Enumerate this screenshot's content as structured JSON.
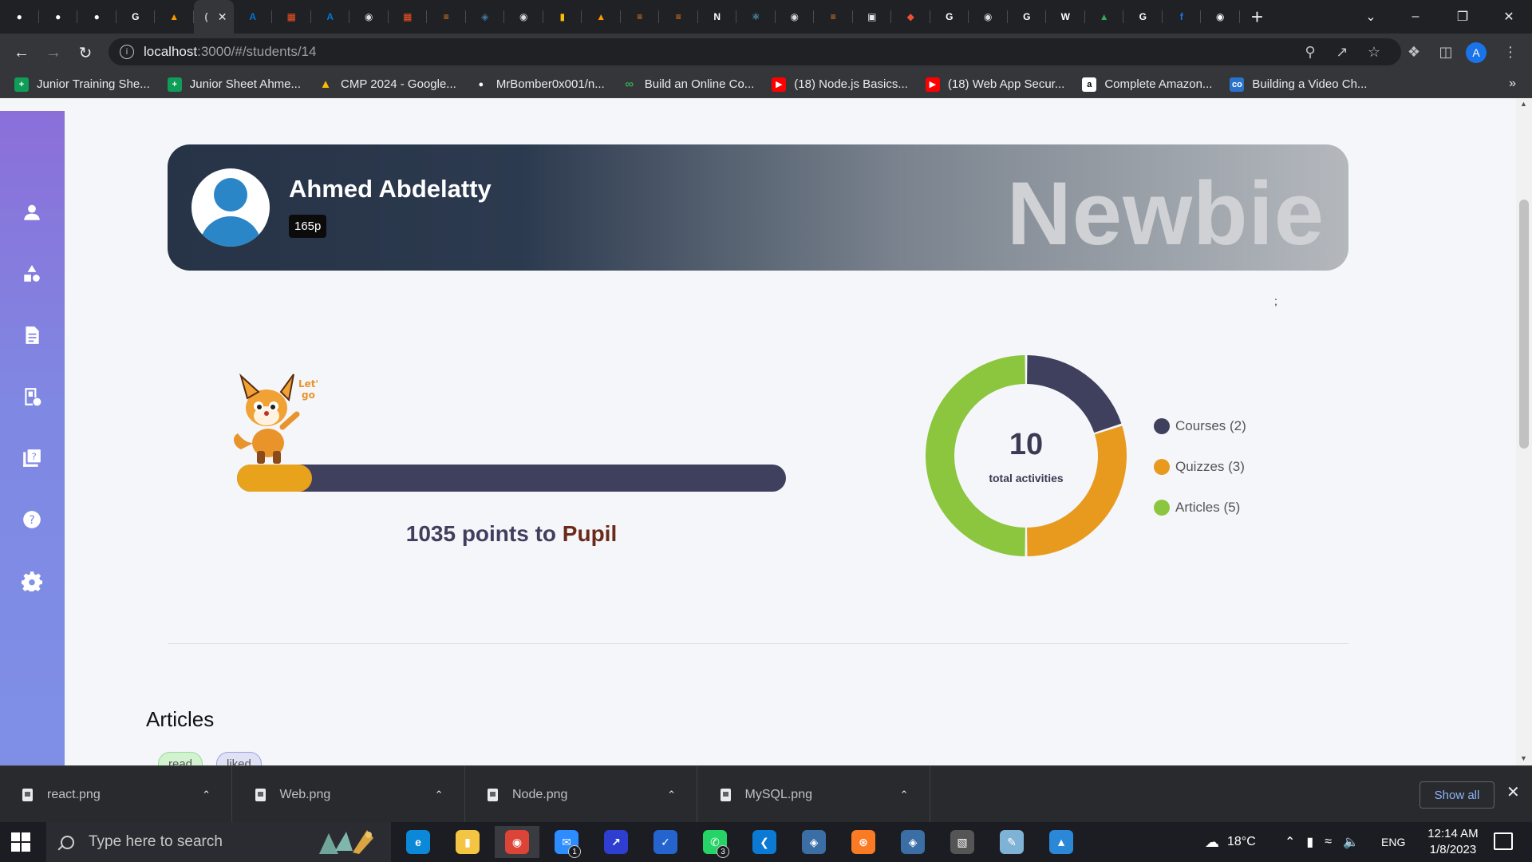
{
  "browser": {
    "tabs": [
      {
        "icon": "github-icon",
        "color": "#ffffff"
      },
      {
        "icon": "github-icon",
        "color": "#ffffff"
      },
      {
        "icon": "github-icon",
        "color": "#ffffff"
      },
      {
        "icon": "google-icon",
        "color": "#ffffff"
      },
      {
        "icon": "codeforces-icon",
        "color": "#ff9800"
      },
      {
        "icon": "localhost-loading-icon",
        "color": "#bdc1c6",
        "active": true
      },
      {
        "icon": "azure-icon",
        "color": "#0078d4"
      },
      {
        "icon": "microsoft-icon",
        "color": "#f25022"
      },
      {
        "icon": "azure-icon",
        "color": "#0078d4"
      },
      {
        "icon": "globe-icon",
        "color": "#dadce0"
      },
      {
        "icon": "microsoft-icon",
        "color": "#f25022"
      },
      {
        "icon": "stackoverflow-icon",
        "color": "#f48024"
      },
      {
        "icon": "mysql-icon",
        "color": "#4479a1"
      },
      {
        "icon": "globe-icon",
        "color": "#dadce0"
      },
      {
        "icon": "bookmark-icon",
        "color": "#fbbc04"
      },
      {
        "icon": "codeforces-icon",
        "color": "#ff9800"
      },
      {
        "icon": "stackoverflow-icon",
        "color": "#f48024"
      },
      {
        "icon": "stackoverflow-icon",
        "color": "#f48024"
      },
      {
        "icon": "notion-icon",
        "color": "#ffffff"
      },
      {
        "icon": "react-icon",
        "color": "#61dafb"
      },
      {
        "icon": "globe-icon",
        "color": "#dadce0"
      },
      {
        "icon": "stackoverflow-icon",
        "color": "#f48024"
      },
      {
        "icon": "package-icon",
        "color": "#e8eaed"
      },
      {
        "icon": "git-icon",
        "color": "#f05032"
      },
      {
        "icon": "google-icon",
        "color": "#ffffff"
      },
      {
        "icon": "globe-icon",
        "color": "#dadce0"
      },
      {
        "icon": "google-icon",
        "color": "#ffffff"
      },
      {
        "icon": "wikipedia-icon",
        "color": "#ffffff"
      },
      {
        "icon": "google-drive-icon",
        "color": "#34a853"
      },
      {
        "icon": "google-icon",
        "color": "#ffffff"
      },
      {
        "icon": "facebook-icon",
        "color": "#1877f2"
      },
      {
        "icon": "chrome-icon",
        "color": "#ffffff"
      }
    ],
    "url_host": "localhost",
    "url_path": ":3000/#/students/14",
    "profile_initial": "A",
    "bookmarks": [
      {
        "label": "Junior Training She...",
        "icon": "sheets-icon",
        "color": "#0f9d58"
      },
      {
        "label": "Junior Sheet Ahme...",
        "icon": "sheets-icon",
        "color": "#0f9d58"
      },
      {
        "label": "CMP 2024 - Google...",
        "icon": "google-drive-icon",
        "color": "#fbbc04"
      },
      {
        "label": "MrBomber0x001/n...",
        "icon": "github-icon",
        "color": "#ffffff"
      },
      {
        "label": "Build an Online Co...",
        "icon": "link-icon",
        "color": "#34a853"
      },
      {
        "label": "(18) Node.js Basics...",
        "icon": "youtube-icon",
        "color": "#ff0000"
      },
      {
        "label": "(18) Web App Secur...",
        "icon": "youtube-icon",
        "color": "#ff0000"
      },
      {
        "label": "Complete Amazon...",
        "icon": "amazon-icon",
        "color": "#ffffff"
      },
      {
        "label": "Building a Video Ch...",
        "icon": "coursera-icon",
        "color": "#2a73cc"
      }
    ]
  },
  "student": {
    "name": "Ahmed Abdelatty",
    "points_badge": "165p",
    "rank": "Newbie"
  },
  "stray_text": ";",
  "progress": {
    "fraction": 0.137,
    "points_needed": "1035 points to ",
    "next_level": "Pupil",
    "fill_color": "#e8a21c",
    "track_color": "#3f3f5e"
  },
  "chart_data": {
    "type": "pie",
    "total": "10",
    "total_caption": "total activities",
    "categories": [
      "Courses (2)",
      "Quizzes (3)",
      "Articles (5)"
    ],
    "values": [
      2,
      3,
      5
    ],
    "colors": [
      "#3f3f5e",
      "#e79a1e",
      "#8cc63f"
    ]
  },
  "articles": {
    "title": "Articles",
    "chips": [
      "read",
      "liked"
    ]
  },
  "downloads": {
    "files": [
      "react.png",
      "Web.png",
      "Node.png",
      "MySQL.png"
    ],
    "show_all": "Show all"
  },
  "taskbar": {
    "search_placeholder": "Type here to search",
    "apps": [
      {
        "icon": "edge-icon",
        "color": "#0c88d8"
      },
      {
        "icon": "file-explorer-icon",
        "color": "#f4c542"
      },
      {
        "icon": "chrome-icon",
        "color": "#db4437",
        "running": true
      },
      {
        "icon": "mail-icon",
        "color": "#2d8cff",
        "badge": "1"
      },
      {
        "icon": "powerautomate-icon",
        "color": "#2e3ed0"
      },
      {
        "icon": "todo-icon",
        "color": "#2564cf"
      },
      {
        "icon": "whatsapp-icon",
        "color": "#25d366",
        "badge": "3"
      },
      {
        "icon": "vscode-icon",
        "color": "#0a7ad4"
      },
      {
        "icon": "mysql-workbench-icon",
        "color": "#3a6ea5"
      },
      {
        "icon": "xampp-icon",
        "color": "#fb7a24"
      },
      {
        "icon": "mysql-workbench-icon",
        "color": "#3a6ea5"
      },
      {
        "icon": "terminal-icon",
        "color": "#555555"
      },
      {
        "icon": "paint-icon",
        "color": "#7fb3d5"
      },
      {
        "icon": "photos-icon",
        "color": "#2b88d8"
      }
    ],
    "weather": "18°C",
    "language": "ENG",
    "time": "12:14 AM",
    "date": "1/8/2023"
  }
}
